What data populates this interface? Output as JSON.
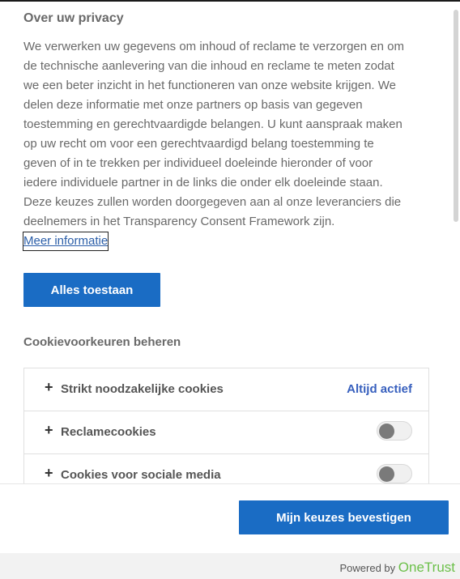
{
  "dialog": {
    "title": "Over uw privacy",
    "description_lines": [
      "We verwerken uw gegevens om inhoud of reclame te verzorgen en om",
      "de technische aanlevering van die inhoud en reclame te meten zodat",
      "we een beter inzicht in het functioneren van onze website krijgen. We",
      "delen deze informatie met onze partners op basis van gegeven",
      "toestemming en gerechtvaardigde belangen. U kunt aanspraak maken",
      "op uw recht om voor een gerechtvaardigd belang toestemming te",
      "geven of in te trekken per individueel doeleinde hieronder of voor",
      "iedere individuele partner in de links die onder elk doeleinde staan.",
      "Deze keuzes zullen worden doorgegeven aan al onze leveranciers die",
      "deelnemers in het Transparency Consent Framework zijn."
    ],
    "more_info_link": "Meer informatie",
    "accept_all_button": "Alles toestaan",
    "preferences_title": "Cookievoorkeuren beheren",
    "preferences": [
      {
        "label": "Strikt noodzakelijke cookies",
        "status": "Altijd actief"
      },
      {
        "label": "Reclamecookies",
        "toggle_on": false
      },
      {
        "label": "Cookies voor sociale media",
        "toggle_on": false
      }
    ],
    "confirm_button": "Mijn keuzes bevestigen"
  },
  "footer": {
    "powered_by": "Powered by",
    "brand": "OneTrust"
  },
  "colors": {
    "primary_button": "#1a6cc4",
    "link": "#2b5ea8",
    "always_active": "#3860be",
    "brand": "#6cc04a"
  }
}
